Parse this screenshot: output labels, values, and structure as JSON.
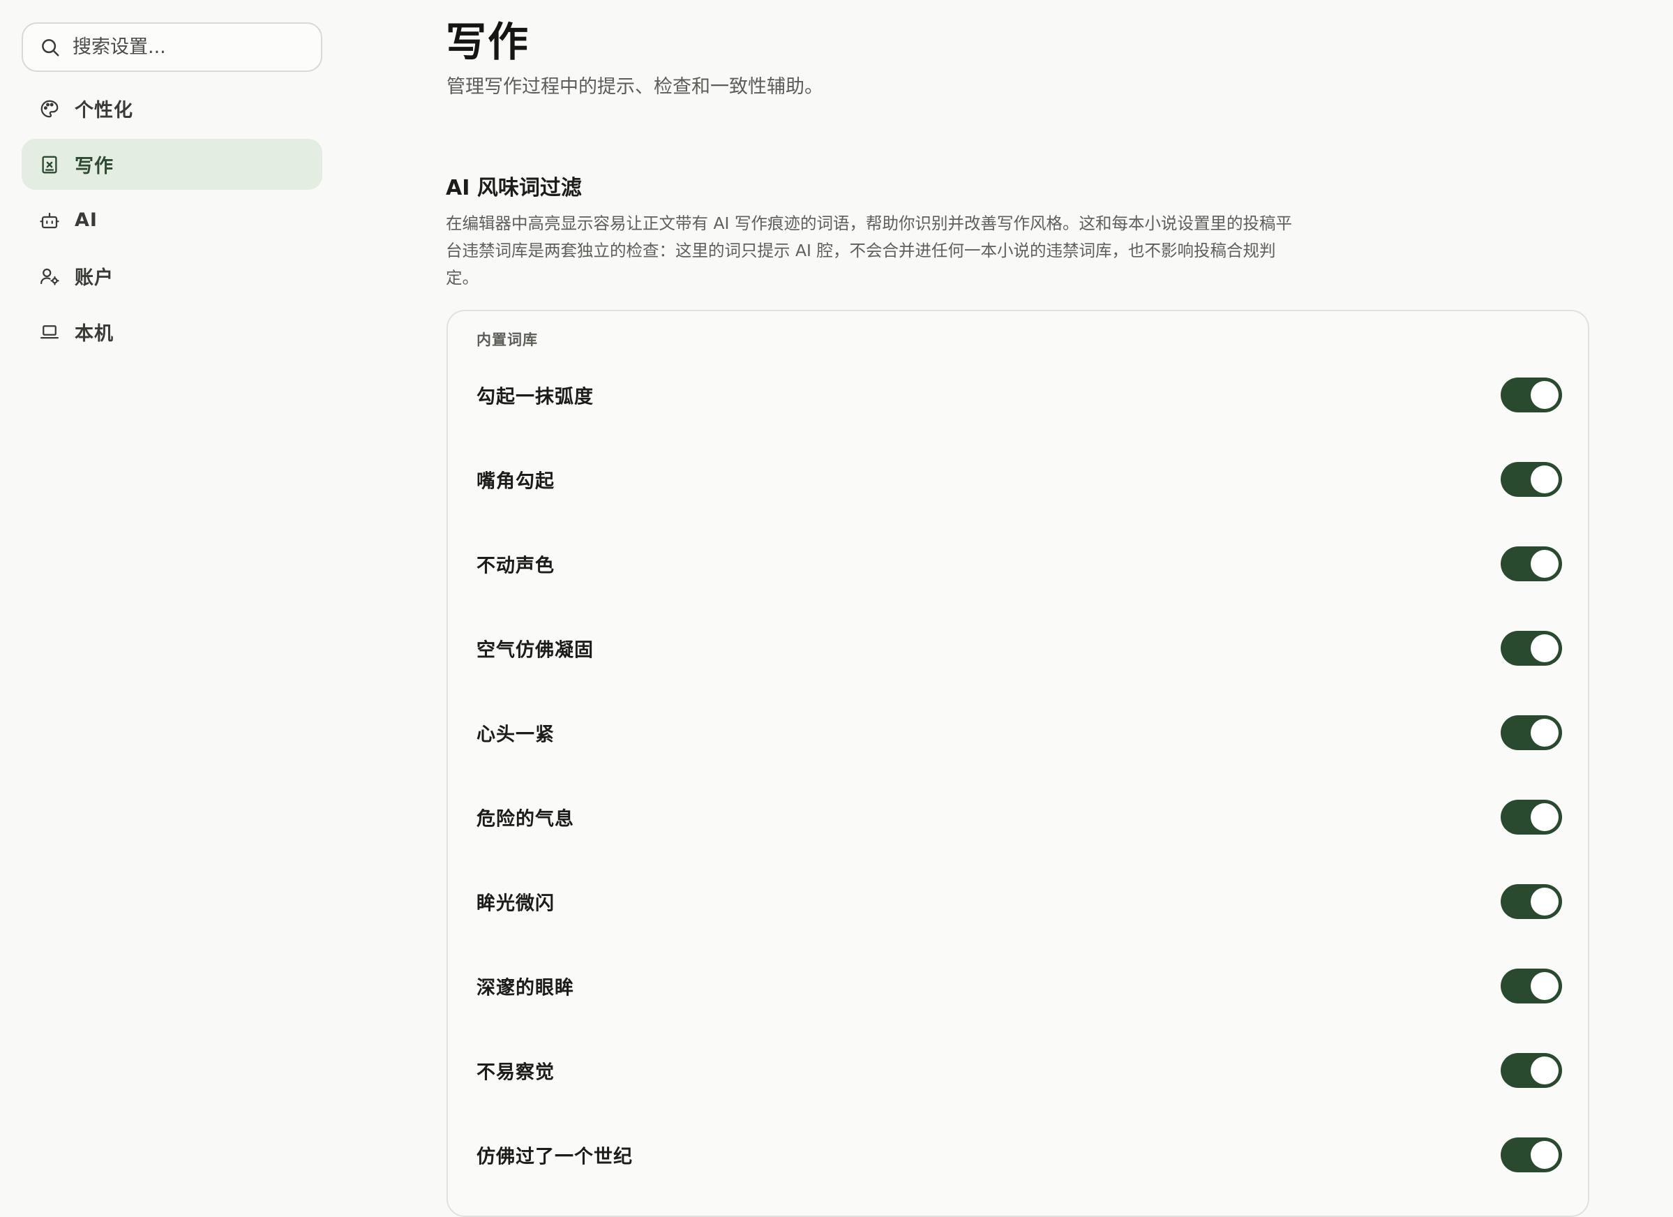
{
  "sidebar": {
    "search": {
      "placeholder": "搜索设置..."
    },
    "items": [
      {
        "label": "个性化",
        "icon": "palette-icon",
        "active": false
      },
      {
        "label": "写作",
        "icon": "document-icon",
        "active": true
      },
      {
        "label": "AI",
        "icon": "bot-icon",
        "active": false
      },
      {
        "label": "账户",
        "icon": "user-gear-icon",
        "active": false
      },
      {
        "label": "本机",
        "icon": "laptop-icon",
        "active": false
      }
    ]
  },
  "main": {
    "title": "写作",
    "subtitle": "管理写作过程中的提示、检查和一致性辅助。",
    "section": {
      "title": "AI 风味词过滤",
      "description_lines": [
        "在编辑器中高亮显示容易让正文带有 AI 写作痕迹的词语，帮助你识别并改善写作风格。这和每本小说设置里的投稿平",
        "台违禁词库是两套独立的检查：这里的词只提示 AI 腔，不会合并进任何一本小说的违禁词库，也不影响投稿合规判",
        "定。"
      ]
    },
    "card": {
      "label": "内置词库",
      "rows": [
        {
          "label": "勾起一抹弧度",
          "enabled": true
        },
        {
          "label": "嘴角勾起",
          "enabled": true
        },
        {
          "label": "不动声色",
          "enabled": true
        },
        {
          "label": "空气仿佛凝固",
          "enabled": true
        },
        {
          "label": "心头一紧",
          "enabled": true
        },
        {
          "label": "危险的气息",
          "enabled": true
        },
        {
          "label": "眸光微闪",
          "enabled": true
        },
        {
          "label": "深邃的眼眸",
          "enabled": true
        },
        {
          "label": "不易察觉",
          "enabled": true
        },
        {
          "label": "仿佛过了一个世纪",
          "enabled": true
        }
      ]
    }
  },
  "colors": {
    "background": "#f9f9f8",
    "active_nav": "#e3ede2",
    "toggle_on": "#2a4a30"
  }
}
